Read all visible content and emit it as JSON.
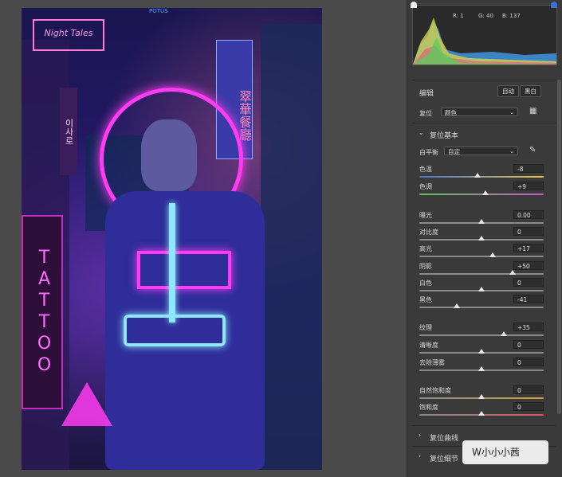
{
  "histogram": {
    "r_label": "R: 1",
    "g_label": "G: 40",
    "b_label": "B: 137"
  },
  "header": {
    "title": "编辑",
    "auto_label": "自动",
    "bw_label": "黑白"
  },
  "reset": {
    "label": "复位",
    "profile_value": "颜色"
  },
  "basic": {
    "title": "复位基本",
    "wb_label": "白平衡",
    "wb_value": "自定",
    "sliders": [
      {
        "label": "色温",
        "value": "-8",
        "level": 0.47
      },
      {
        "label": "色调",
        "value": "+9",
        "level": 0.53
      },
      {
        "label": "曝光",
        "value": "0.00",
        "level": 0.5
      },
      {
        "label": "对比度",
        "value": "0",
        "level": 0.5
      },
      {
        "label": "高光",
        "value": "+17",
        "level": 0.59
      },
      {
        "label": "阴影",
        "value": "+50",
        "level": 0.75
      },
      {
        "label": "白色",
        "value": "0",
        "level": 0.5
      },
      {
        "label": "黑色",
        "value": "-41",
        "level": 0.3
      },
      {
        "label": "纹理",
        "value": "+35",
        "level": 0.68
      },
      {
        "label": "清晰度",
        "value": "0",
        "level": 0.5
      },
      {
        "label": "去除薄雾",
        "value": "0",
        "level": 0.5
      },
      {
        "label": "自然饱和度",
        "value": "0",
        "level": 0.5
      },
      {
        "label": "饱和度",
        "value": "0",
        "level": 0.5
      }
    ]
  },
  "sections": {
    "curve_label": "复位曲线",
    "detail_label": "复位细节"
  },
  "photo": {
    "sign_top": "Night Tales",
    "sign_tattoo": "TATTOO",
    "sign_vertical": "翠華餐廳",
    "sign_korean": "이사로",
    "top_text": "POTUS"
  },
  "watermark": {
    "text": "W小小小茜"
  },
  "colors": {
    "accent": "#7a3cff",
    "neon_pink": "#ff3cf2",
    "neon_cyan": "#8fe6ff"
  }
}
